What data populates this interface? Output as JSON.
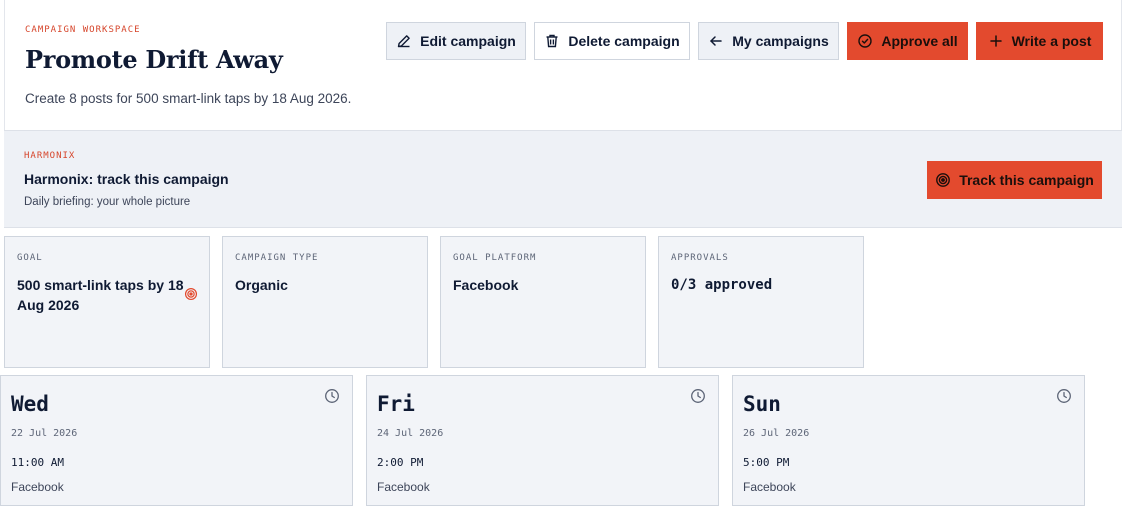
{
  "header": {
    "eyebrow": "CAMPAIGN WORKSPACE",
    "title": "Promote Drift Away",
    "subtitle": "Create 8 posts for 500 smart-link taps by 18 Aug 2026."
  },
  "toolbar": {
    "edit_label": "Edit campaign",
    "delete_label": "Delete campaign",
    "my_campaigns_label": "My campaigns",
    "approve_all_label": "Approve all",
    "write_post_label": "Write a post"
  },
  "banner": {
    "eyebrow": "HARMONIX",
    "title": "Harmonix: track this campaign",
    "subtitle": "Daily briefing: your whole picture",
    "button_label": "Track this campaign"
  },
  "stats": [
    {
      "label": "GOAL",
      "value": "500 smart-link taps by 18 Aug 2026",
      "icon": "target-icon"
    },
    {
      "label": "CAMPAIGN TYPE",
      "value": "Organic"
    },
    {
      "label": "GOAL PLATFORM",
      "value": "Facebook"
    },
    {
      "label": "APPROVALS",
      "value": "0/3 approved"
    }
  ],
  "schedule": [
    {
      "day": "Wed",
      "date": "22 Jul 2026",
      "time": "11:00 AM",
      "platform": "Facebook"
    },
    {
      "day": "Fri",
      "date": "24 Jul 2026",
      "time": "2:00 PM",
      "platform": "Facebook"
    },
    {
      "day": "Sun",
      "date": "26 Jul 2026",
      "time": "5:00 PM",
      "platform": "Facebook"
    }
  ],
  "colors": {
    "accent": "#e34a2e",
    "eyebrow": "#d6452b",
    "panel": "#eef1f6",
    "text": "#0f1a33"
  }
}
